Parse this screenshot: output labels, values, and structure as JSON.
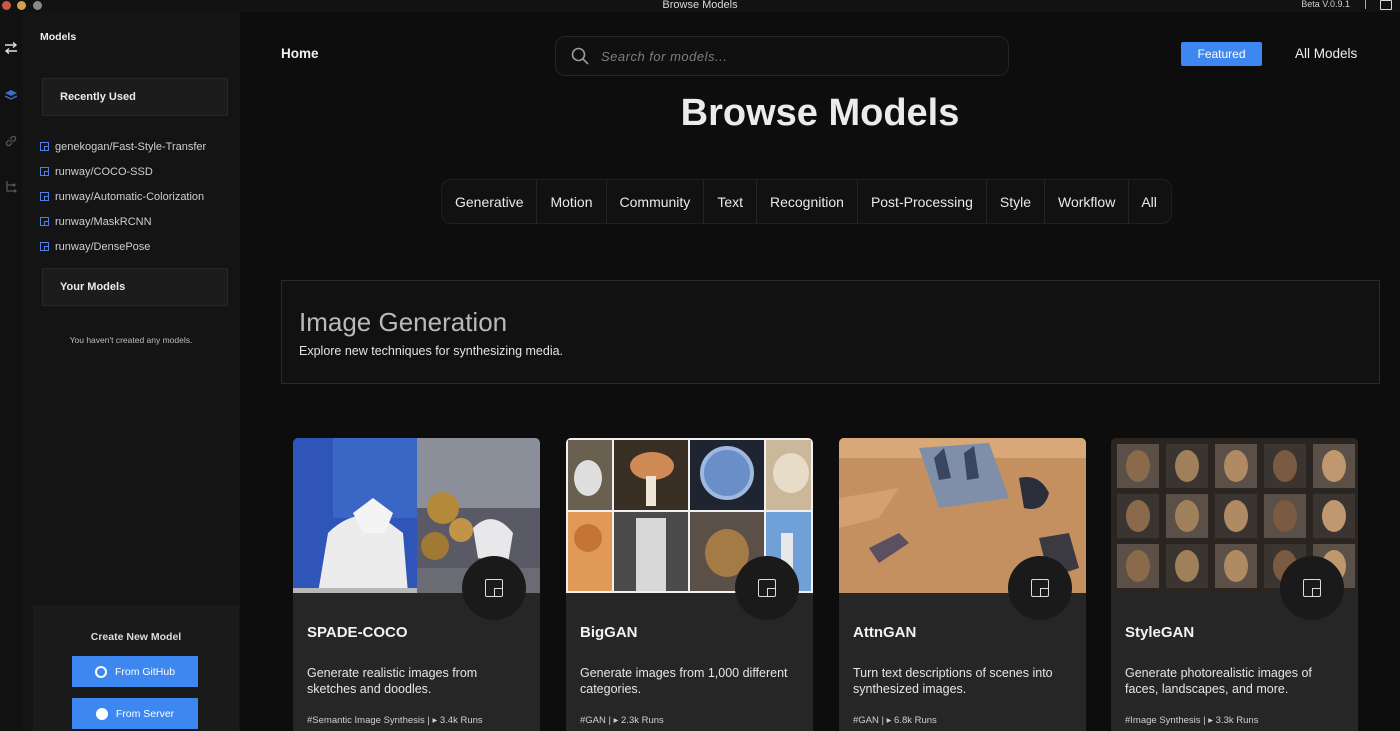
{
  "window": {
    "title": "Browse Models",
    "version": "Beta V.0.9.1"
  },
  "sidebar": {
    "title": "Models",
    "recently_used_label": "Recently Used",
    "recent_items": [
      "genekogan/Fast-Style-Transfer",
      "runway/COCO-SSD",
      "runway/Automatic-Colorization",
      "runway/MaskRCNN",
      "runway/DensePose"
    ],
    "your_models_label": "Your Models",
    "empty_message": "You haven't created any models.",
    "create": {
      "title": "Create New Model",
      "github_label": "From GitHub",
      "server_label": "From Server"
    }
  },
  "header": {
    "home_label": "Home",
    "search_placeholder": "Search for models...",
    "featured_label": "Featured",
    "all_models_label": "All Models"
  },
  "page": {
    "heading": "Browse Models",
    "categories": [
      "Generative",
      "Motion",
      "Community",
      "Text",
      "Recognition",
      "Post-Processing",
      "Style",
      "Workflow",
      "All"
    ]
  },
  "section": {
    "title": "Image Generation",
    "subtitle": "Explore new techniques for synthesizing media."
  },
  "cards": [
    {
      "name": "SPADE-COCO",
      "description": "Generate realistic images from sketches and doodles.",
      "meta": "#Semantic Image Synthesis | ▸ 3.4k Runs"
    },
    {
      "name": "BigGAN",
      "description": "Generate images from 1,000 different categories.",
      "meta": "#GAN | ▸ 2.3k Runs"
    },
    {
      "name": "AttnGAN",
      "description": "Turn text descriptions of scenes into synthesized images.",
      "meta": "#GAN | ▸ 6.8k Runs"
    },
    {
      "name": "StyleGAN",
      "description": "Generate photorealistic images of faces, landscapes, and more.",
      "meta": "#Image Synthesis | ▸ 3.3k Runs"
    }
  ],
  "colors": {
    "accent": "#3d87f0",
    "background": "#0d0d0d",
    "card": "#262626"
  }
}
